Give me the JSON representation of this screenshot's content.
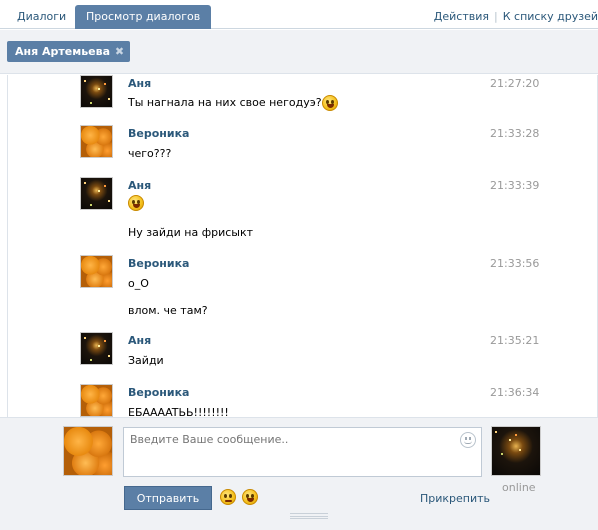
{
  "tabs": {
    "dialogs": "Диалоги",
    "view_dialogs": "Просмотр диалогов"
  },
  "toplinks": {
    "actions": "Действия",
    "separator": "|",
    "to_friends": "К списку друзей"
  },
  "filter": {
    "chip_name": "Аня Артемьева",
    "chip_close": "✖"
  },
  "messages": [
    {
      "author": "Аня",
      "avatar": "anya-avatar",
      "time": "21:27:20",
      "lines": [
        "Ты нагнала на них свое негодуэ?"
      ],
      "has_smiley": true
    },
    {
      "author": "Вероника",
      "avatar": "veronika-avatar",
      "time": "21:33:28",
      "lines": [
        "чего???"
      ]
    },
    {
      "author": "Аня",
      "avatar": "anya-avatar",
      "time": "21:33:39",
      "lines": [
        "",
        "Ну зайди на фрисыкт"
      ],
      "has_smiley": true
    },
    {
      "author": "Вероника",
      "avatar": "veronika-avatar",
      "time": "21:33:56",
      "lines": [
        "о_О",
        "влом. че там?"
      ]
    },
    {
      "author": "Аня",
      "avatar": "anya-avatar",
      "time": "21:35:21",
      "lines": [
        "Зайди"
      ]
    },
    {
      "author": "Вероника",
      "avatar": "veronika-avatar",
      "time": "21:36:34",
      "lines": [
        "ЕБАААATЬЬ!!!!!!!!"
      ]
    }
  ],
  "composer": {
    "placeholder": "Введите Ваше сообщение..",
    "send_label": "Отправить",
    "attach_label": "Прикрепить",
    "status": "online"
  },
  "colors": {
    "accent": "#5b7fa6",
    "link": "#2b587a",
    "panel": "#f0f2f5"
  }
}
